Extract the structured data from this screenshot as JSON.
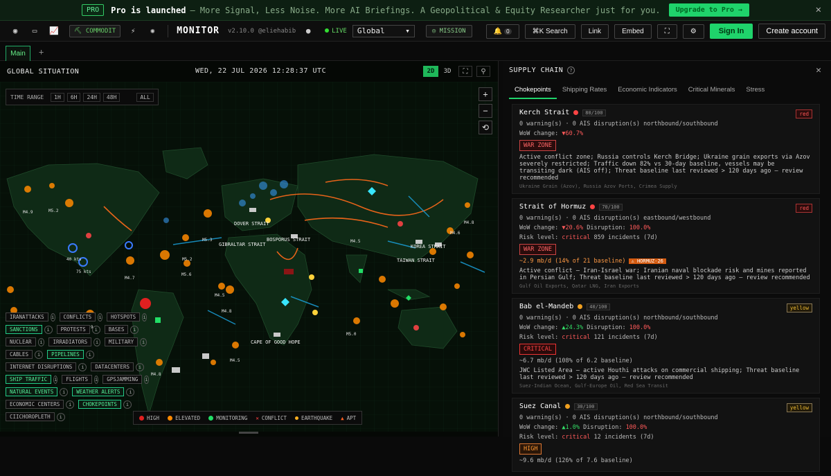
{
  "banner": {
    "pro_tag": "PRO",
    "title": "Pro is launched",
    "text": "– More Signal, Less Noise. More AI Briefings. A Geopolitical & Equity Researcher just for you.",
    "upgrade": "Upgrade to Pro →",
    "close": "✕"
  },
  "topbar": {
    "commodity_label": "COMMODIT",
    "logo": "MONITOR",
    "version": "v2.10.0",
    "author": "@eliehabib",
    "live": "LIVE",
    "region": "Global",
    "mission": "MISSION",
    "alerts_count": "0",
    "search": "⌘K  Search",
    "link": "Link",
    "embed": "Embed",
    "sign_in": "Sign In",
    "create_account": "Create account"
  },
  "tabs": {
    "main": "Main",
    "add": "+"
  },
  "panel": {
    "title": "GLOBAL SITUATION",
    "datetime": "WED, 22 JUL 2026 12:28:37 UTC",
    "view_2d": "2D",
    "view_3d": "3D"
  },
  "time_range": {
    "label": "TIME RANGE",
    "options": [
      "1H",
      "6H",
      "24H",
      "48H",
      "ALL"
    ]
  },
  "map_labels": {
    "dover": "DOVER STRAIT",
    "gibraltar": "GIBRALTAR STRAIT",
    "bosporus": "BOSPORUS STRAIT",
    "korea": "KOREA STRAIT",
    "taiwan": "TAIWAN STRAIT",
    "cape": "CAPE OF GOOD HOPE",
    "m1": "M4.9",
    "m2": "M5.2",
    "m3": "M5.3",
    "m4": "M5.2",
    "m5": "M5.6",
    "m6": "M4.5",
    "m7": "M4.5",
    "m8": "M4.8",
    "m9": "M4.9",
    "m10": "M5.0",
    "m11": "M4.5",
    "m12": "M4.8",
    "m13": "M4.6",
    "m14": "M4.8",
    "m15": "M4.7",
    "kts1": "40 kts",
    "kts2": "75 kts"
  },
  "layers": [
    [
      {
        "label": "IRANATTACKS",
        "on": false
      },
      {
        "label": "CONFLICTS",
        "on": false
      },
      {
        "label": "HOTSPOTS",
        "on": false
      }
    ],
    [
      {
        "label": "SANCTIONS",
        "on": true
      },
      {
        "label": "PROTESTS",
        "on": false
      },
      {
        "label": "BASES",
        "on": false
      }
    ],
    [
      {
        "label": "NUCLEAR",
        "on": false
      },
      {
        "label": "IRRADIATORS",
        "on": false
      },
      {
        "label": "MILITARY",
        "on": false
      }
    ],
    [
      {
        "label": "CABLES",
        "on": false
      },
      {
        "label": "PIPELINES",
        "on": true
      }
    ],
    [
      {
        "label": "INTERNET DISRUPTIONS",
        "on": false
      },
      {
        "label": "DATACENTERS",
        "on": false
      }
    ],
    [
      {
        "label": "SHIP TRAFFIC",
        "on": true
      },
      {
        "label": "FLIGHTS",
        "on": false
      },
      {
        "label": "GPSJAMMING",
        "on": false
      }
    ],
    [
      {
        "label": "NATURAL EVENTS",
        "on": true
      },
      {
        "label": "WEATHER ALERTS",
        "on": true
      }
    ],
    [
      {
        "label": "ECONOMIC CENTERS",
        "on": false
      },
      {
        "label": "CHOKEPOINTS",
        "on": true
      }
    ],
    [
      {
        "label": "CIICHOROPLETH",
        "on": false
      }
    ]
  ],
  "legend": {
    "high": "HIGH",
    "elevated": "ELEVATED",
    "monitoring": "MONITORING",
    "conflict": "CONFLICT",
    "earthquake": "EARTHQUAKE",
    "apt": "APT"
  },
  "supply_chain": {
    "title": "SUPPLY CHAIN",
    "tabs": [
      "Chokepoints",
      "Shipping Rates",
      "Economic Indicators",
      "Critical Minerals",
      "Stress"
    ],
    "cards": [
      {
        "name": "Kerch Strait",
        "dot": "#ff4444",
        "score": "80/100",
        "level": "red",
        "line1": "0 warning(s) · 0 AIS disruption(s) northbound/southbound",
        "wow_label": "WoW change:",
        "wow": "▼60.7%",
        "wow_color": "red",
        "tag": "WAR ZONE",
        "desc": "Active conflict zone; Russia controls Kerch Bridge; Ukraine grain exports via Azov severely restricted; Traffic down 82% vs 30-day baseline, vessels may be transiting dark (AIS off); Threat baseline last reviewed > 120 days ago — review recommended",
        "route": "Ukraine Grain (Azov), Russia Azov Ports, Crimea Supply"
      },
      {
        "name": "Strait of Hormuz",
        "dot": "#ff4444",
        "score": "70/100",
        "level": "red",
        "line1": "0 warning(s) · 0 AIS disruption(s) eastbound/westbound",
        "wow_label": "WoW change:",
        "wow": "▼20.6%",
        "disruption_label": "Disruption:",
        "disruption": "100.0%",
        "risk_label": "Risk level:",
        "risk": "critical",
        "incidents": "859 incidents (7d)",
        "tag": "WAR ZONE",
        "flow": "~2.9 mb/d (14% of 21 baseline)",
        "flow_tag": "⚠ HORMUZ-26",
        "desc": "Active conflict — Iran-Israel war; Iranian naval blockade risk and mines reported in Persian Gulf; Threat baseline last reviewed > 120 days ago — review recommended",
        "route": "Gulf Oil Exports, Qatar LNG, Iran Exports"
      },
      {
        "name": "Bab el-Mandeb",
        "dot": "#f0a020",
        "score": "40/100",
        "level": "yellow",
        "line1": "0 warning(s) · 0 AIS disruption(s) northbound/southbound",
        "wow_label": "WoW change:",
        "wow": "▲24.3%",
        "disruption_label": "Disruption:",
        "disruption": "100.0%",
        "risk_label": "Risk level:",
        "risk": "critical",
        "incidents": "121 incidents (7d)",
        "tag": "CRITICAL",
        "flow": "~6.7 mb/d (108% of 6.2 baseline)",
        "desc": "JWC Listed Area — active Houthi attacks on commercial shipping; Threat baseline last reviewed > 120 days ago — review recommended",
        "route": "Suez-Indian Ocean, Gulf-Europe Oil, Red Sea Transit"
      },
      {
        "name": "Suez Canal",
        "dot": "#f0a020",
        "score": "30/100",
        "level": "yellow",
        "line1": "0 warning(s) · 0 AIS disruption(s) northbound/southbound",
        "wow_label": "WoW change:",
        "wow": "▲1.0%",
        "disruption_label": "Disruption:",
        "disruption": "100.0%",
        "risk_label": "Risk level:",
        "risk": "critical",
        "incidents": "12 incidents (7d)",
        "tag": "HIGH",
        "flow": "~9.6 mb/d (126% of 7.6 baseline)"
      }
    ]
  }
}
